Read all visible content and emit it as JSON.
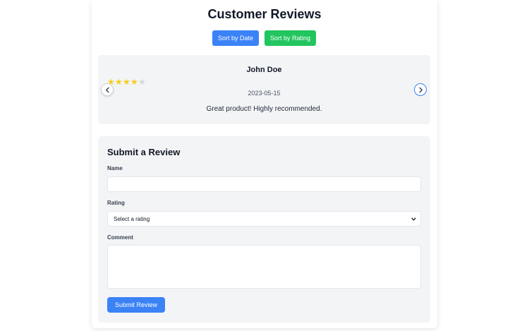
{
  "header": {
    "title": "Customer Reviews",
    "sort_date_label": "Sort by Date",
    "sort_rating_label": "Sort by Rating"
  },
  "review": {
    "name": "John Doe",
    "rating": 4,
    "max_rating": 5,
    "date": "2023-05-15",
    "comment": "Great product! Highly recommended."
  },
  "form": {
    "title": "Submit a Review",
    "name_label": "Name",
    "name_value": "",
    "rating_label": "Rating",
    "rating_selected": "Select a rating",
    "comment_label": "Comment",
    "comment_value": "",
    "submit_label": "Submit Review"
  },
  "icons": {
    "prev": "chevron-left-icon",
    "next": "chevron-right-icon",
    "select": "chevron-down-icon",
    "star": "star-icon"
  },
  "colors": {
    "primary": "#3b82f6",
    "success": "#22c55e",
    "star_on": "#facc15",
    "star_off": "#d1d5db"
  }
}
